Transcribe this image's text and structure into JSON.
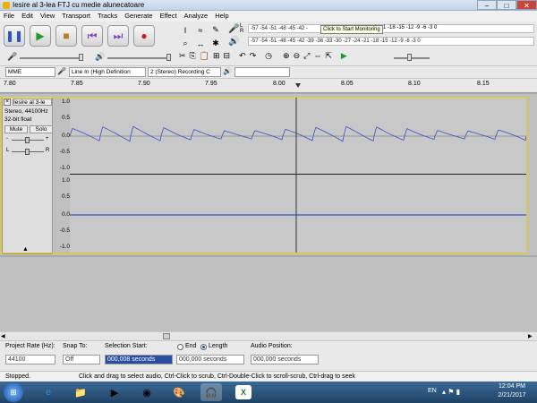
{
  "window": {
    "title": "Iesire al 3-lea FTJ cu medie alunecatoare",
    "buttons": {
      "minimize": "–",
      "maximize": "□",
      "close": "✕"
    }
  },
  "menu": [
    "File",
    "Edit",
    "View",
    "Transport",
    "Tracks",
    "Generate",
    "Effect",
    "Analyze",
    "Help"
  ],
  "transport": {
    "buttons": [
      {
        "name": "pause-button",
        "glyph": "❚❚",
        "color": "#2f52c8"
      },
      {
        "name": "play-button",
        "glyph": "▶",
        "color": "#1f9a2f"
      },
      {
        "name": "stop-button",
        "glyph": "■",
        "color": "#b87f1e"
      },
      {
        "name": "skip-start-button",
        "glyph": "⏮",
        "color": "#7a3fc4"
      },
      {
        "name": "skip-end-button",
        "glyph": "⏭",
        "color": "#7a3fc4"
      },
      {
        "name": "record-button",
        "glyph": "●",
        "color": "#c81e1e"
      }
    ]
  },
  "meters": {
    "record_scale": "-57 -54 -51 -48 -45 -42 -",
    "monitor_hint": "Click to Start Monitoring",
    "record_scale_right": "1 -18 -15 -12 -9 -6 -3 0",
    "playback_scale": "-57 -54 -51 -48 -45 -42 -39 -36 -33 -30 -27 -24 -21 -18 -15 -12 -9 -6 -3 0",
    "left": "L",
    "right": "R"
  },
  "device": {
    "host": "MME",
    "input": "Line In (High Definition",
    "channels": "2 (Stereo) Recording C",
    "output": ""
  },
  "ruler": {
    "ticks": [
      "7.80",
      "7.85",
      "7.90",
      "7.95",
      "8.00",
      "8.05",
      "8.10",
      "8.15"
    ]
  },
  "track": {
    "name": "Iesire al 3-le",
    "info1": "Stereo, 44100Hz",
    "info2": "32-bit float",
    "mute": "Mute",
    "solo": "Solo",
    "gain_minus": "-",
    "gain_plus": "+",
    "pan_left": "L",
    "pan_right": "R",
    "axis_top": [
      "1.0",
      "0.5",
      "0.0",
      "-0.5",
      "-1.0"
    ],
    "axis_bottom": [
      "1.0",
      "0.5",
      "0.0",
      "-0.5",
      "-1.0"
    ]
  },
  "selection": {
    "project_rate_label": "Project Rate (Hz):",
    "project_rate": "44100",
    "snap_label": "Snap To:",
    "snap_value": "Off",
    "start_label": "Selection Start:",
    "start_value": "000,008 seconds",
    "end_label": "End",
    "length_label": "Length",
    "length_value": "000,000 seconds",
    "audio_pos_label": "Audio Position:",
    "audio_pos_value": "000,000 seconds"
  },
  "status": {
    "state": "Stopped.",
    "hint": "Click and drag to select audio, Ctrl-Click to scrub, Ctrl-Double-Click to scroll-scrub, Ctrl-drag to seek"
  },
  "taskbar": {
    "time": "12:04 PM",
    "date": "2/21/2017",
    "language": "EN"
  },
  "colors": {
    "waveform": "#3b4fc9",
    "selection_border": "#e8d000"
  }
}
